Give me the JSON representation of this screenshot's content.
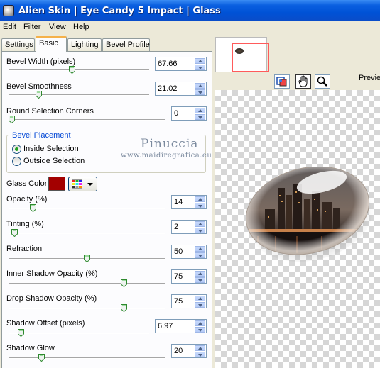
{
  "window": {
    "title": "Alien Skin | Eye Candy 5 Impact | Glass"
  },
  "menu": [
    "Edit",
    "Filter",
    "View",
    "Help"
  ],
  "tabs": [
    "Settings",
    "Basic",
    "Lighting",
    "Bevel Profile"
  ],
  "active_tab": "Basic",
  "controls": {
    "bevel_width": {
      "label": "Bevel Width (pixels)",
      "value": "67.66",
      "slider_fraction": 0.45
    },
    "bevel_smoothness": {
      "label": "Bevel Smoothness",
      "value": "21.02",
      "slider_fraction": 0.2
    },
    "round_corners": {
      "label": "Round Selection Corners",
      "value": "0",
      "slider_fraction": 0.0
    },
    "opacity": {
      "label": "Opacity (%)",
      "value": "14",
      "slider_fraction": 0.14
    },
    "tinting": {
      "label": "Tinting (%)",
      "value": "2",
      "slider_fraction": 0.02
    },
    "refraction": {
      "label": "Refraction",
      "value": "50",
      "slider_fraction": 0.5
    },
    "inner_shadow_opacity": {
      "label": "Inner Shadow Opacity (%)",
      "value": "75",
      "slider_fraction": 0.75
    },
    "drop_shadow_opacity": {
      "label": "Drop Shadow Opacity (%)",
      "value": "75",
      "slider_fraction": 0.75
    },
    "shadow_offset": {
      "label": "Shadow Offset (pixels)",
      "value": "6.97",
      "slider_fraction": 0.07
    },
    "shadow_glow": {
      "label": "Shadow Glow",
      "value": "20",
      "slider_fraction": 0.2
    }
  },
  "bevel_placement": {
    "label": "Bevel Placement",
    "options": [
      "Inside Selection",
      "Outside Selection"
    ],
    "selected": "Inside Selection"
  },
  "glass_color": {
    "label": "Glass Color",
    "color": "#a30000"
  },
  "watermark": {
    "name": "Pinuccia",
    "site": "www.maidiregrafica.eu"
  },
  "preview": {
    "label": "Previe"
  },
  "tools": [
    "preview-toggle-icon",
    "hand-icon",
    "zoom-icon"
  ],
  "colors": {
    "titlebar": "#0052d6",
    "panel": "#fcfcfe",
    "tab_highlight": "#f5b14a",
    "nav_frame": "#ff5b5b"
  }
}
